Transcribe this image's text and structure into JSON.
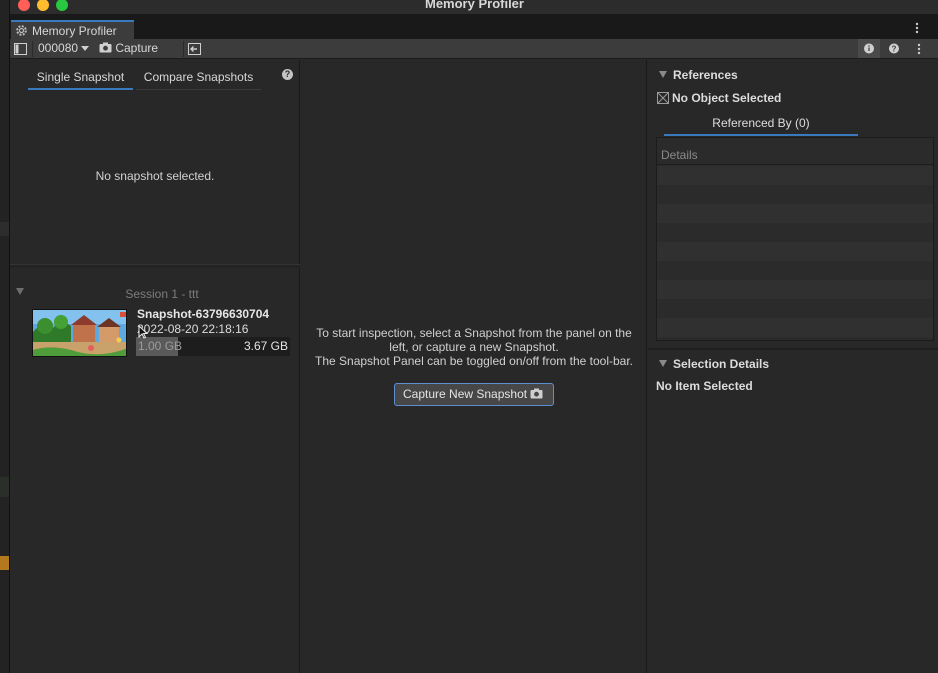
{
  "window": {
    "title": "Memory Profiler",
    "tab_label": "Memory Profiler"
  },
  "toolbar": {
    "target_value": "000080",
    "capture_label": "Capture"
  },
  "left_panel": {
    "tabs": [
      {
        "label": "Single Snapshot",
        "active": true
      },
      {
        "label": "Compare Snapshots",
        "active": false
      }
    ],
    "empty_message": "No snapshot selected.",
    "session": {
      "label": "Session 1 - ttt",
      "snapshots": [
        {
          "name": "Snapshot-63796630704",
          "date": "2022-08-20 22:18:16",
          "used_memory": "1.00 GB",
          "total_memory": "3.67 GB",
          "used_fraction": 0.27
        }
      ]
    }
  },
  "center_panel": {
    "message_lines": [
      "To start inspection, select a Snapshot from the panel on the",
      "left, or capture a new Snapshot.",
      "The Snapshot Panel can be toggled on/off from the tool-bar."
    ],
    "capture_button_label": "Capture New Snapshot"
  },
  "right_panel": {
    "references_title": "References",
    "no_object_label": "No Object Selected",
    "referenced_by_tab": "Referenced By (0)",
    "details_header": "Details",
    "selection_details_title": "Selection Details",
    "no_item_label": "No Item Selected"
  },
  "colors": {
    "accent": "#3a79bb",
    "panel_bg": "#282828",
    "toolbar_bg": "#3c3c3c"
  },
  "icons": [
    "gear-icon",
    "panel-toggle-icon",
    "camera-icon",
    "import-icon",
    "info-icon",
    "help-icon",
    "kebab-menu-icon"
  ]
}
